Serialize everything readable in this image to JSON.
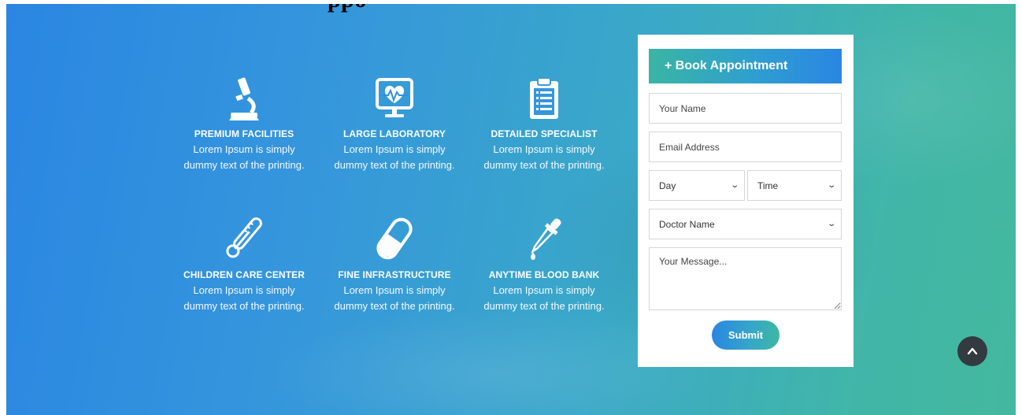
{
  "page": {
    "partial_title": "ppo"
  },
  "features": [
    {
      "icon": "microscope-icon",
      "title": "PREMIUM FACILITIES",
      "desc_line1": "Lorem Ipsum is simply",
      "desc_line2": "dummy text of the printing."
    },
    {
      "icon": "heart-monitor-icon",
      "title": "LARGE LABORATORY",
      "desc_line1": "Lorem Ipsum is simply",
      "desc_line2": "dummy text of the printing."
    },
    {
      "icon": "clipboard-icon",
      "title": "DETAILED SPECIALIST",
      "desc_line1": "Lorem Ipsum is simply",
      "desc_line2": "dummy text of the printing."
    },
    {
      "icon": "thermometer-icon",
      "title": "CHILDREN CARE CENTER",
      "desc_line1": "Lorem Ipsum is simply",
      "desc_line2": "dummy text of the printing."
    },
    {
      "icon": "pill-capsule-icon",
      "title": "FINE INFRASTRUCTURE",
      "desc_line1": "Lorem Ipsum is simply",
      "desc_line2": "dummy text of the printing."
    },
    {
      "icon": "dropper-icon",
      "title": "ANYTIME BLOOD BANK",
      "desc_line1": "Lorem Ipsum is simply",
      "desc_line2": "dummy text of the printing."
    }
  ],
  "form": {
    "heading": "+ Book Appointment",
    "name_placeholder": "Your Name",
    "email_placeholder": "Email Address",
    "day_selected": "Day",
    "time_selected": "Time",
    "doctor_selected": "Doctor Name",
    "message_placeholder": "Your Message...",
    "submit_label": "Submit"
  },
  "colors": {
    "gradient_start": "#2a86e2",
    "gradient_end": "#44b89e",
    "scroll_top_bg": "#333a40"
  },
  "icons": {
    "scroll_top": "chevron-up-icon",
    "select_arrow": "chevron-down-icon"
  }
}
